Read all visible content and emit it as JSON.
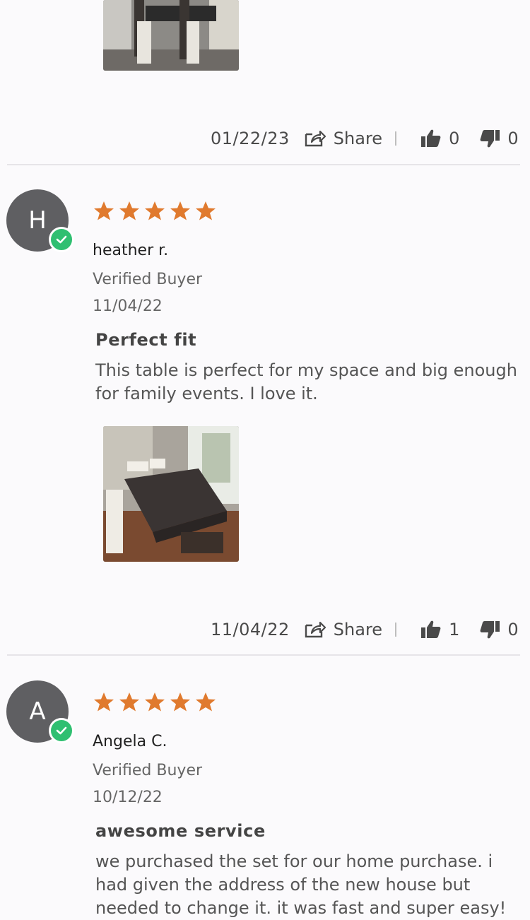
{
  "colors": {
    "star": "#e07a2e",
    "verified": "#2fbf71",
    "avatar_bg": "#5f5f62"
  },
  "top_review": {
    "date": "01/22/23",
    "share_label": "Share",
    "helpful_count": "0",
    "unhelpful_count": "0"
  },
  "reviews": [
    {
      "avatar_letter": "H",
      "rating": 5,
      "name": "heather r.",
      "badge": "Verified Buyer",
      "date": "11/04/22",
      "title": "Perfect fit",
      "body": "This table is perfect for my space and big enough for family events. I love it.",
      "footer_date": "11/04/22",
      "share_label": "Share",
      "helpful_count": "1",
      "unhelpful_count": "0"
    },
    {
      "avatar_letter": "A",
      "rating": 5,
      "name": "Angela C.",
      "badge": "Verified Buyer",
      "date": "10/12/22",
      "title": "awesome service",
      "body": "we purchased the set for our home purchase. i had given the address of the new house but needed to change it. it was fast and super easy!"
    }
  ],
  "icons": [
    "share-icon",
    "thumbs-up-icon",
    "thumbs-down-icon",
    "star-icon",
    "verified-check-icon"
  ]
}
